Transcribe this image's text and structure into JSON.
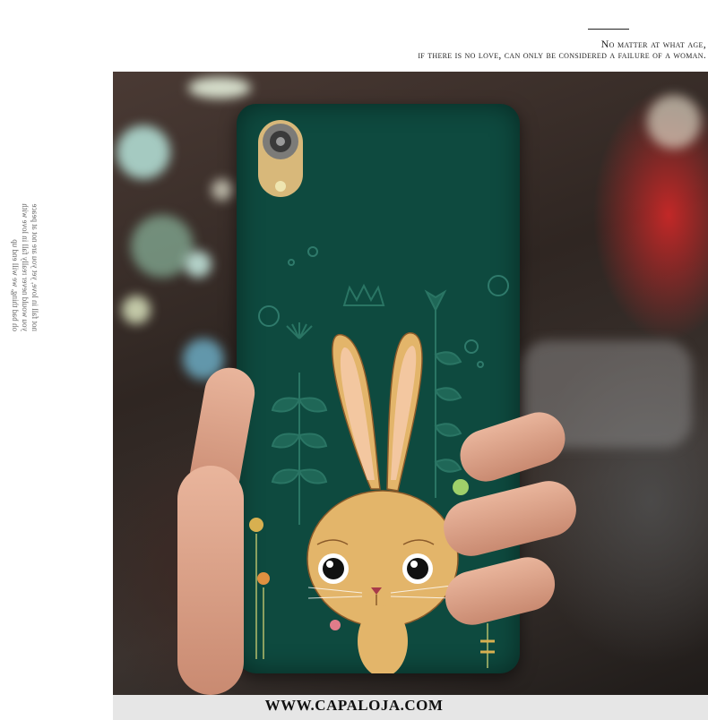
{
  "quote": {
    "line1": "No matter at what age,",
    "line2": "if there is no love, can only be considered a failure of a woman."
  },
  "side_text": {
    "lines": [
      "not fall in love, yet you are not at peace",
      "you would never really fall in love with",
      "oh bad thing, we will end up"
    ]
  },
  "footer": {
    "website": "WWW.CAPALOJA.COM"
  },
  "colors": {
    "case_green": "#0e4a3f",
    "rabbit": "#e3b56a"
  }
}
